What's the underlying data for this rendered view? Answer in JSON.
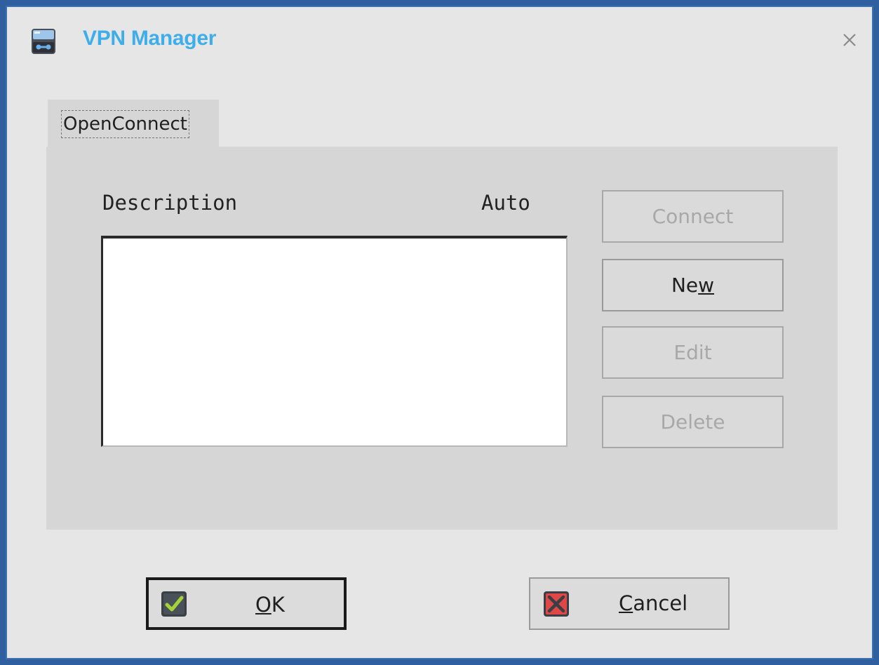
{
  "window": {
    "title": "VPN Manager",
    "accent_color": "#3daee9",
    "icons": {
      "app": "vpn-app-icon",
      "close": "close-icon"
    }
  },
  "tabs": [
    {
      "label": "OpenConnect",
      "selected": true
    }
  ],
  "list": {
    "columns": [
      "Description",
      "Auto"
    ],
    "rows": []
  },
  "side_buttons": {
    "connect": {
      "label_before": "Connect",
      "accel": "",
      "label_after": "",
      "enabled": false
    },
    "new": {
      "label_before": "Ne",
      "accel": "w",
      "label_after": "",
      "enabled": true
    },
    "edit": {
      "label_before": "Edit",
      "accel": "",
      "label_after": "",
      "enabled": false
    },
    "delete": {
      "label_before": "Delete",
      "accel": "",
      "label_after": "",
      "enabled": false
    }
  },
  "dialog_buttons": {
    "ok": {
      "accel": "O",
      "label_after": "K",
      "icon": "checkmark-icon",
      "default": true
    },
    "cancel": {
      "accel": "C",
      "label_after": "ancel",
      "icon": "cancel-x-icon"
    }
  }
}
